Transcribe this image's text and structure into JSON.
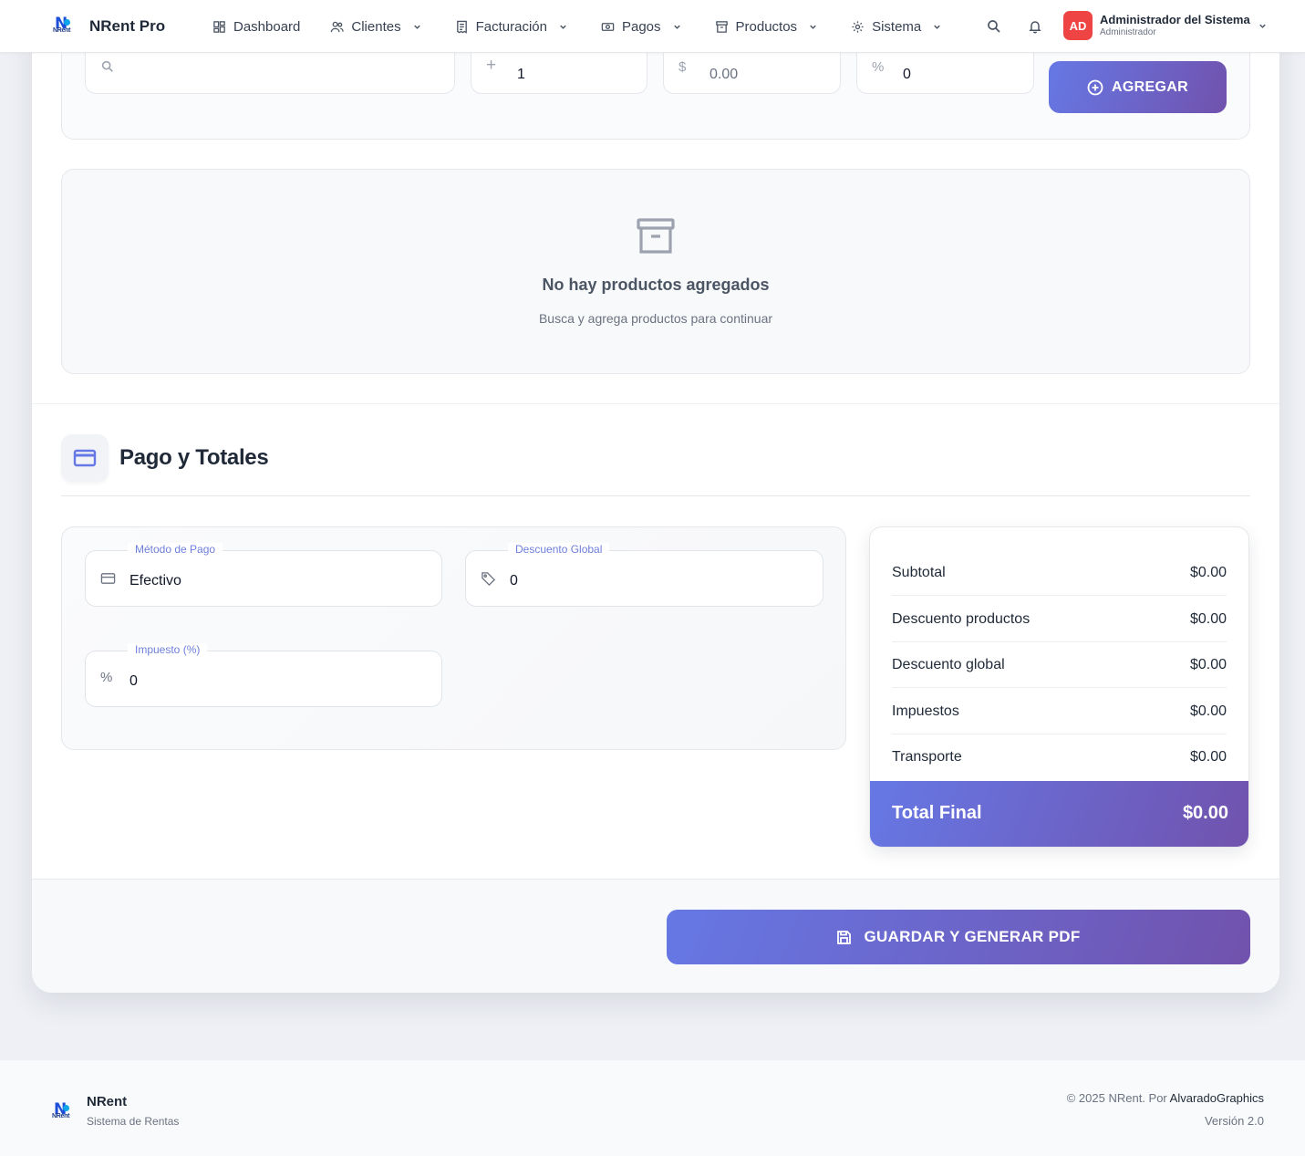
{
  "app": {
    "brand": "NRent Pro",
    "logo_text": "NRent"
  },
  "nav": {
    "items": [
      {
        "label": "Dashboard",
        "icon": "dashboard-icon",
        "has_dropdown": false
      },
      {
        "label": "Clientes",
        "icon": "users-icon",
        "has_dropdown": true
      },
      {
        "label": "Facturación",
        "icon": "receipt-icon",
        "has_dropdown": true
      },
      {
        "label": "Pagos",
        "icon": "money-icon",
        "has_dropdown": true
      },
      {
        "label": "Productos",
        "icon": "archive-icon",
        "has_dropdown": true
      },
      {
        "label": "Sistema",
        "icon": "gear-icon",
        "has_dropdown": true
      }
    ]
  },
  "user": {
    "initials": "AD",
    "name": "Administrador del Sistema",
    "role": "Administrador"
  },
  "add_product": {
    "quantity": "1",
    "price_placeholder": "0.00",
    "discount": "0",
    "add_button": "AGREGAR"
  },
  "empty_state": {
    "title": "No hay productos agregados",
    "subtitle": "Busca y agrega productos para continuar"
  },
  "payment": {
    "section_title": "Pago y Totales",
    "method_label": "Método de Pago",
    "method_value": "Efectivo",
    "global_discount_label": "Descuento Global",
    "global_discount_value": "0",
    "tax_label": "Impuesto (%)",
    "tax_value": "0"
  },
  "totals": {
    "rows": [
      {
        "label": "Subtotal",
        "value": "$0.00"
      },
      {
        "label": "Descuento productos",
        "value": "$0.00"
      },
      {
        "label": "Descuento global",
        "value": "$0.00"
      },
      {
        "label": "Impuestos",
        "value": "$0.00"
      },
      {
        "label": "Transporte",
        "value": "$0.00"
      }
    ],
    "final_label": "Total Final",
    "final_value": "$0.00"
  },
  "save_button": "GUARDAR Y GENERAR PDF",
  "footer": {
    "name": "NRent",
    "subtitle": "Sistema de Rentas",
    "copyright": "© 2025 NRent. Por",
    "author": "AlvaradoGraphics",
    "version": "Versión 2.0"
  },
  "colors": {
    "accent_start": "#6678e5",
    "accent_end": "#7152ad",
    "avatar": "#ef4444"
  }
}
